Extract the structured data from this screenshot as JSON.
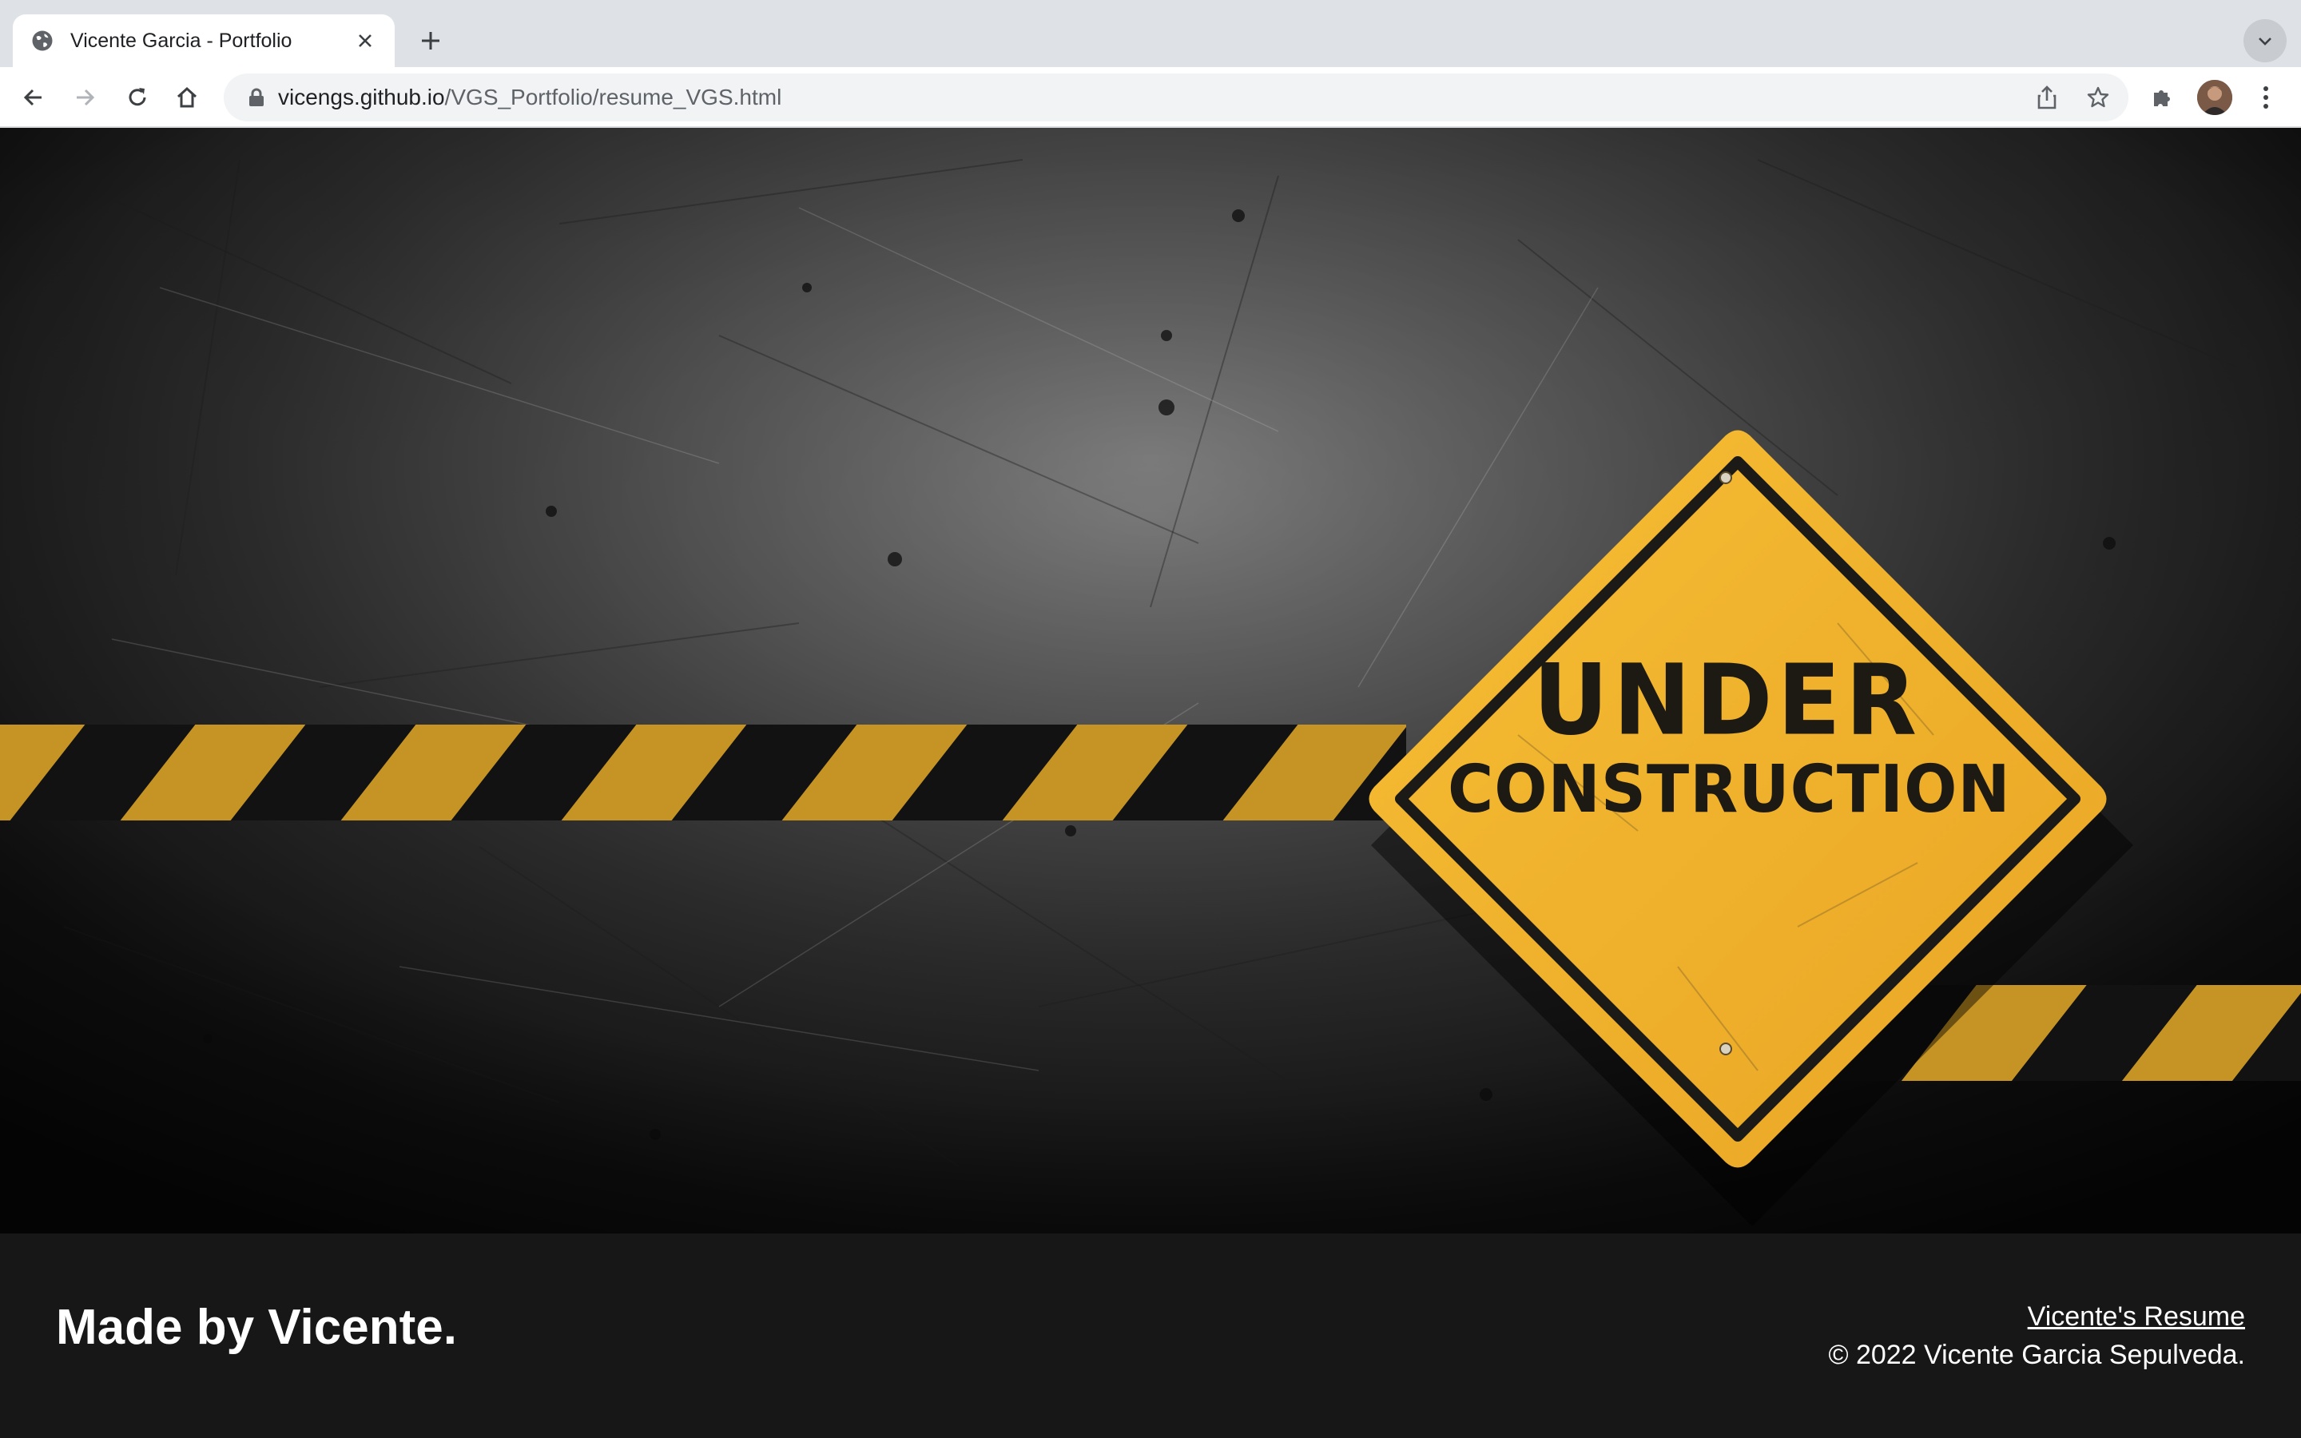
{
  "browser": {
    "tab_title": "Vicente Garcia - Portfolio",
    "url_host": "vicengs.github.io",
    "url_path": "/VGS_Portfolio/resume_VGS.html"
  },
  "hero": {
    "sign_line1": "UNDER",
    "sign_line2": "CONSTRUCTION"
  },
  "footer": {
    "made_by": "Made by Vicente.",
    "resume_link": "Vicente's Resume",
    "copyright": "© 2022 Vicente Garcia Sepulveda."
  },
  "colors": {
    "sign_yellow": "#f2b12a",
    "tape_black": "#151515",
    "footer_bg": "#171717"
  }
}
